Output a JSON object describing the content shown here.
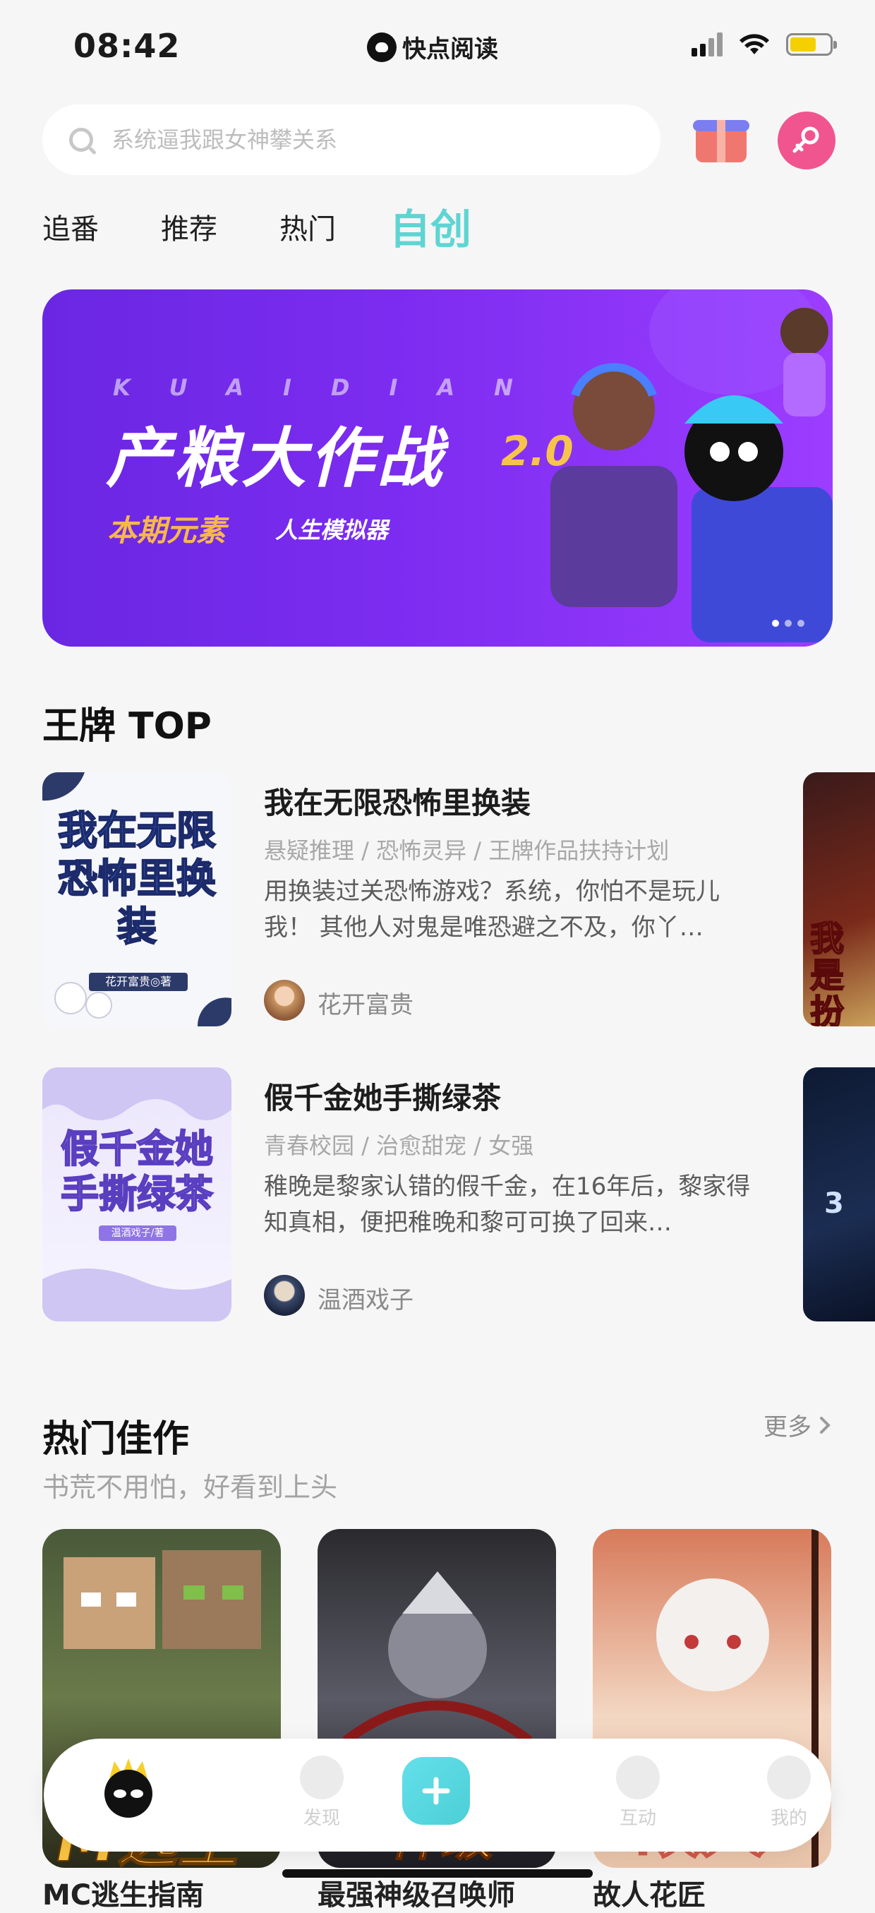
{
  "status_bar": {
    "time": "08:42",
    "app_name": "快点阅读"
  },
  "search": {
    "placeholder": "系统逼我跟女神攀关系"
  },
  "tabs": [
    {
      "label": "追番",
      "active": false
    },
    {
      "label": "推荐",
      "active": false
    },
    {
      "label": "热门",
      "active": false
    },
    {
      "label": "自创",
      "active": true
    }
  ],
  "banner": {
    "letters": "KUAIDIAN",
    "title": "产粮大作战",
    "version": "2.0",
    "element_label": "本期元素",
    "element_value": "人生模拟器",
    "page_count": 3,
    "current_page": 1
  },
  "ace_section": {
    "title": "王牌 TOP",
    "books": [
      {
        "title": "我在无限恐怖里换装",
        "tags": "悬疑推理 / 恐怖灵异 / 王牌作品扶持计划",
        "desc": "用换装过关恐怖游戏？系统，你怕不是玩儿我！ 其他人对鬼是唯恐避之不及，你丫…",
        "author": "花开富贵",
        "cover_text": "我在无限恐怖里换装",
        "cover_author": "花开富贵◎著"
      },
      {
        "title": "假千金她手撕绿茶",
        "tags": "青春校园 / 治愈甜宠 / 女强",
        "desc": "稚晚是黎家认错的假千金，在16年后，黎家得知真相，便把稚晚和黎可可换了回来…",
        "author": "温酒戏子",
        "cover_text": "假千金她手撕绿茶",
        "cover_author": "温酒戏子/著"
      }
    ]
  },
  "hot_section": {
    "title": "热门佳作",
    "subtitle": "书荒不用怕，好看到上头",
    "more_label": "更多",
    "items": [
      {
        "title": "MC逃生指南",
        "cover_text": "M逃生"
      },
      {
        "title": "最强神级召唤师",
        "cover_text": "神级"
      },
      {
        "title": "故人花匠",
        "cover_text": "故人"
      }
    ]
  },
  "bottom_nav": [
    {
      "label": "",
      "icon": "home-mascot-icon"
    },
    {
      "label": "发现",
      "icon": "discover-icon"
    },
    {
      "label": "",
      "icon": "plus-icon"
    },
    {
      "label": "互动",
      "icon": "chat-icon"
    },
    {
      "label": "我的",
      "icon": "profile-icon"
    }
  ],
  "colors": {
    "accent": "#5ed5d3",
    "banner": "#7c2cf0",
    "pink": "#f0558f"
  }
}
